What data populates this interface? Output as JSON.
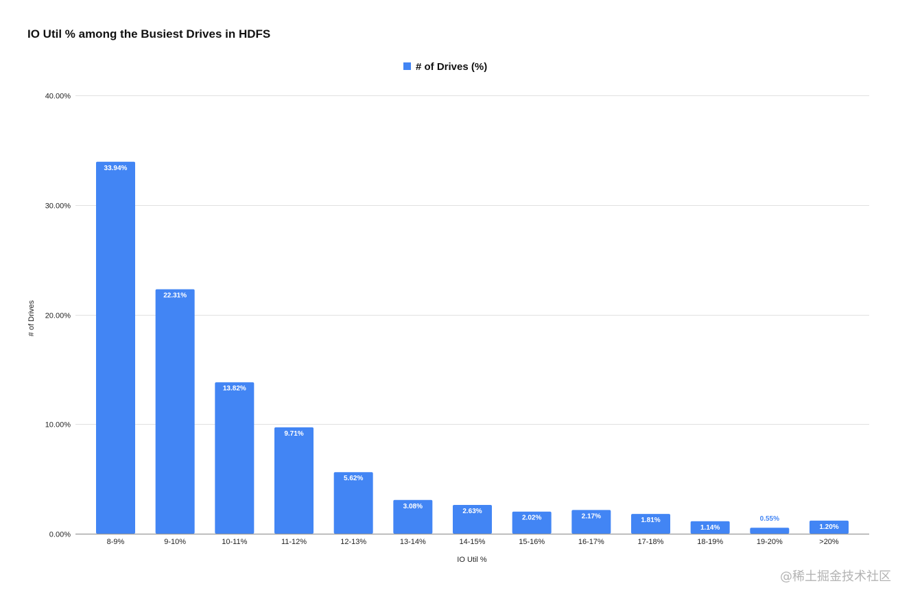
{
  "chart_data": {
    "type": "bar",
    "title": "IO Util % among the Busiest Drives in HDFS",
    "xlabel": "IO Util %",
    "ylabel": "# of Drives",
    "categories": [
      "8-9%",
      "9-10%",
      "10-11%",
      "11-12%",
      "12-13%",
      "13-14%",
      "14-15%",
      "15-16%",
      "16-17%",
      "17-18%",
      "18-19%",
      "19-20%",
      ">20%"
    ],
    "series": [
      {
        "name": "# of Drives (%)",
        "values": [
          33.94,
          22.31,
          13.82,
          9.71,
          5.62,
          3.08,
          2.63,
          2.02,
          2.17,
          1.81,
          1.14,
          0.55,
          1.2
        ],
        "labels": [
          "33.94%",
          "22.31%",
          "13.82%",
          "9.71%",
          "5.62%",
          "3.08%",
          "2.63%",
          "2.02%",
          "2.17%",
          "1.81%",
          "1.14%",
          "0.55%",
          "1.20%"
        ]
      }
    ],
    "ylim": [
      0,
      40
    ],
    "yticks": [
      0,
      10,
      20,
      30,
      40
    ],
    "ytick_labels": [
      "0.00%",
      "10.00%",
      "20.00%",
      "30.00%",
      "40.00%"
    ],
    "grid": true,
    "legend_position": "top-center"
  },
  "colors": {
    "bar": "#4285f4",
    "gridline": "#e0e0e0",
    "axis": "#999999",
    "label_inside": "#ffffff",
    "label_outside": "#4285f4"
  },
  "watermark": "@稀土掘金技术社区"
}
